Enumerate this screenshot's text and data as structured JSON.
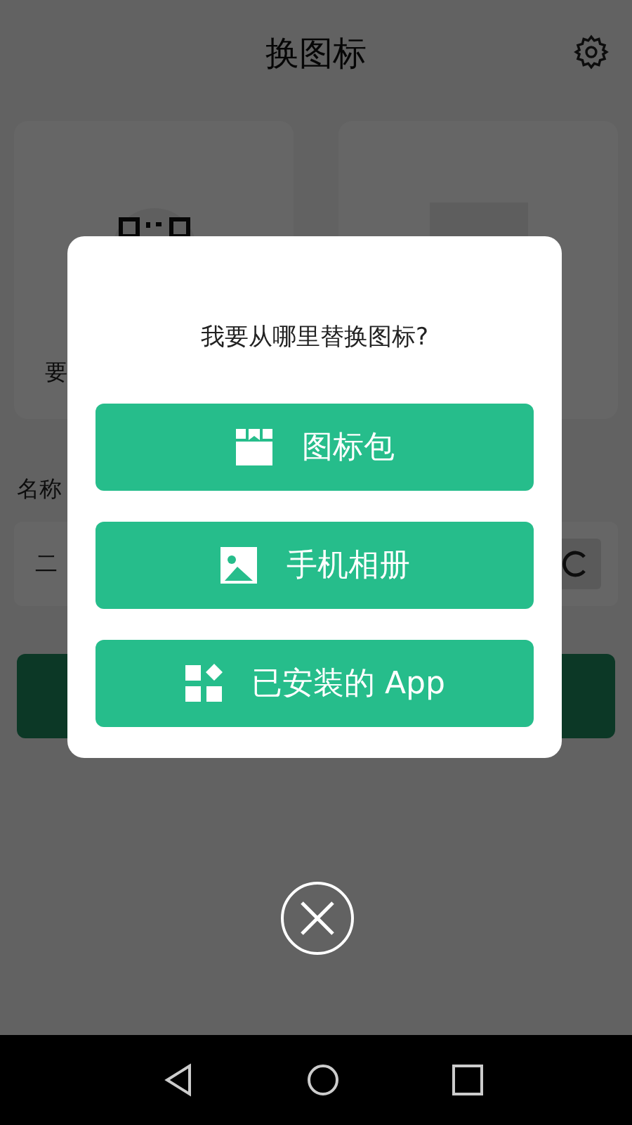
{
  "header": {
    "title": "换图标"
  },
  "source_card": {
    "caption": "要"
  },
  "name_field": {
    "label": "名称",
    "value": "二"
  },
  "dialog": {
    "title": "我要从哪里替换图标?",
    "options": [
      {
        "kind": "pack",
        "label": "图标包"
      },
      {
        "kind": "gallery",
        "label": "手机相册"
      },
      {
        "kind": "apps",
        "label": "已安装的 App"
      }
    ]
  }
}
